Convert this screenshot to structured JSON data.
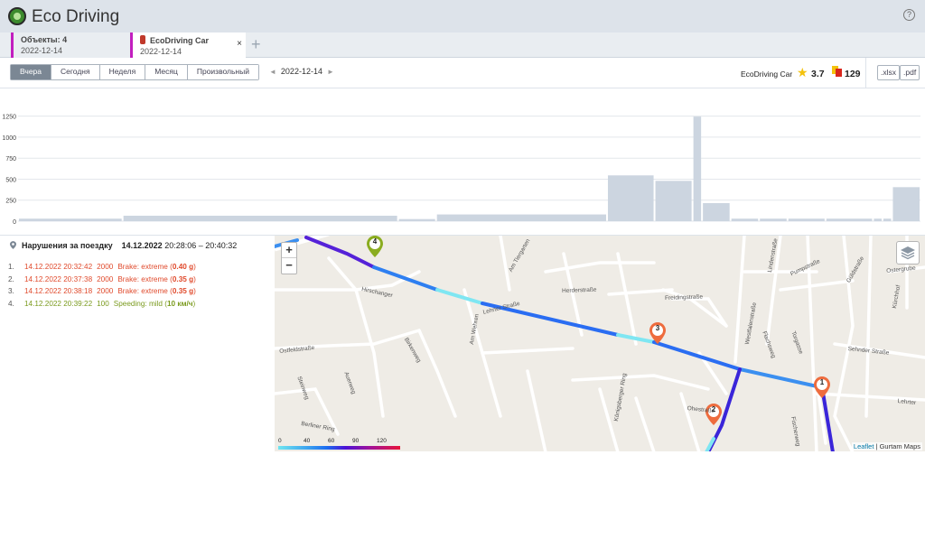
{
  "app": {
    "title": "Eco Driving",
    "help_label": "?"
  },
  "tabs": [
    {
      "title": "Объекты: 4",
      "date": "2022-12-14"
    },
    {
      "title": "EcoDriving Car",
      "date": "2022-12-14",
      "close": "×"
    }
  ],
  "add_tab": "+",
  "toolbar": {
    "ranges": [
      "Вчера",
      "Сегодня",
      "Неделя",
      "Месяц",
      "Произвольный"
    ],
    "active_range": "Вчера",
    "date": "2022-12-14",
    "prev": "◄",
    "next": "►",
    "unit_name": "EcoDriving Car",
    "rating": "3.7",
    "violations_count": "129",
    "exports": [
      ".xlsx",
      ".pdf"
    ]
  },
  "chart_data": {
    "type": "bar",
    "y_ticks": [
      "0",
      "250",
      "500",
      "750",
      "1000",
      "1250"
    ],
    "ylim": [
      0,
      1300
    ],
    "bars": [
      {
        "x0": 0,
        "x1": 11,
        "value": 30
      },
      {
        "x0": 11,
        "x1": 40,
        "value": 65
      },
      {
        "x0": 40,
        "x1": 44,
        "value": 25
      },
      {
        "x0": 44,
        "x1": 62,
        "value": 80
      },
      {
        "x0": 62,
        "x1": 67,
        "value": 545
      },
      {
        "x0": 67,
        "x1": 71,
        "value": 480
      },
      {
        "x0": 71,
        "x1": 72,
        "value": 1245
      },
      {
        "x0": 72,
        "x1": 75,
        "value": 215
      },
      {
        "x0": 75,
        "x1": 78,
        "value": 30
      },
      {
        "x0": 78,
        "x1": 81,
        "value": 30
      },
      {
        "x0": 81,
        "x1": 85,
        "value": 30
      },
      {
        "x0": 85,
        "x1": 90,
        "value": 30
      },
      {
        "x0": 90,
        "x1": 91,
        "value": 30
      },
      {
        "x0": 91,
        "x1": 92,
        "value": 30
      },
      {
        "x0": 92,
        "x1": 95,
        "value": 405
      }
    ],
    "bar_color": "#ccd5e0"
  },
  "violations": {
    "heading": "Нарушения за поездку",
    "trip_date": "14.12.2022",
    "trip_time": "20:28:06 – 20:40:32",
    "items": [
      {
        "num": "1.",
        "time": "14.12.2022 20:32:42",
        "value": "2000",
        "type": "Brake: extreme (",
        "detail": "0.40 g",
        "close": ")",
        "color": "red"
      },
      {
        "num": "2.",
        "time": "14.12.2022 20:37:38",
        "value": "2000",
        "type": "Brake: extreme (",
        "detail": "0.35 g",
        "close": ")",
        "color": "red"
      },
      {
        "num": "3.",
        "time": "14.12.2022 20:38:18",
        "value": "2000",
        "type": "Brake: extreme (",
        "detail": "0.35 g",
        "close": ")",
        "color": "red"
      },
      {
        "num": "4.",
        "time": "14.12.2022 20:39:22",
        "value": "100",
        "type": "Speeding: mild (",
        "detail": "10 км/ч",
        "close": ")",
        "color": "green"
      }
    ]
  },
  "map": {
    "zoom_in": "+",
    "zoom_out": "−",
    "attribution_link": "Leaflet",
    "attribution_text": " | Gurtam Maps",
    "speed_legend": [
      "0",
      "40",
      "60",
      "90",
      "120"
    ],
    "markers": [
      "1",
      "2",
      "3",
      "4"
    ],
    "streets": [
      "Lehrter Straße",
      "Herderstraße",
      "Freidingstraße",
      "Hirschanger",
      "Ostfeldstraße",
      "Am Wehren",
      "Am Tiergarten",
      "Birkenweg",
      "Ostergrube",
      "Sehnder Straße",
      "Pumpstraße",
      "Güldstraße",
      "Fischerweg",
      "Königsberger Ring",
      "Ohestraße",
      "Auerweg",
      "Berliner Ring",
      "Lindenstraße",
      "Kürchhof",
      "Torgasse",
      "Lehrter",
      "Westfalenstraße",
      "Steinweg",
      "Flachsweg"
    ]
  },
  "colors": {
    "accent": "#c21ebf",
    "red": "#e04a2c",
    "green": "#7a9a1d",
    "marker_orange": "#ee6c3e",
    "marker_green": "#8aac1f"
  }
}
